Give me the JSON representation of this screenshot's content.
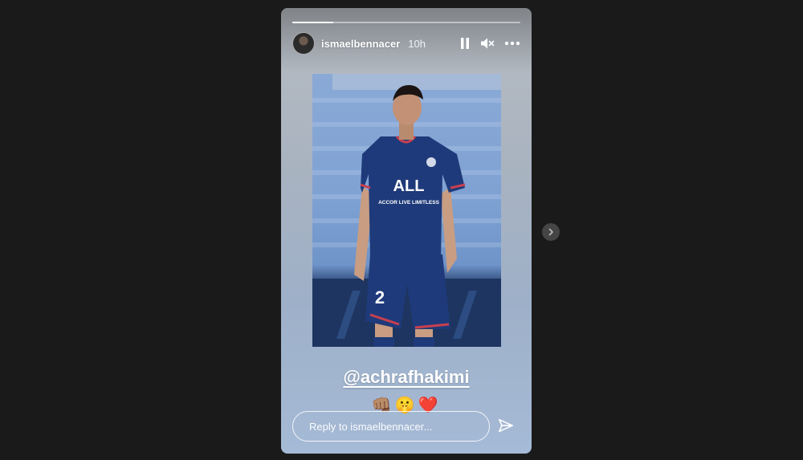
{
  "story": {
    "progress": 0.18,
    "username": "ismaelbennacer",
    "time": "10h",
    "mention": "@achrafhakimi",
    "emojis": "👊🏽🤫❤️",
    "photo": {
      "jersey_number": "2",
      "sponsor_logo": "ALL",
      "sponsor_text": "ACCOR LIVE LIMITLESS"
    },
    "reply_placeholder": "Reply to ismaelbennacer..."
  },
  "icons": {
    "pause": "pause-icon",
    "mute": "mute-icon",
    "more": "more-icon",
    "send": "send-icon",
    "next": "chevron-right-icon"
  },
  "colors": {
    "background": "#1a1a1a",
    "jersey": "#1f3a7a",
    "text": "#ffffff"
  }
}
